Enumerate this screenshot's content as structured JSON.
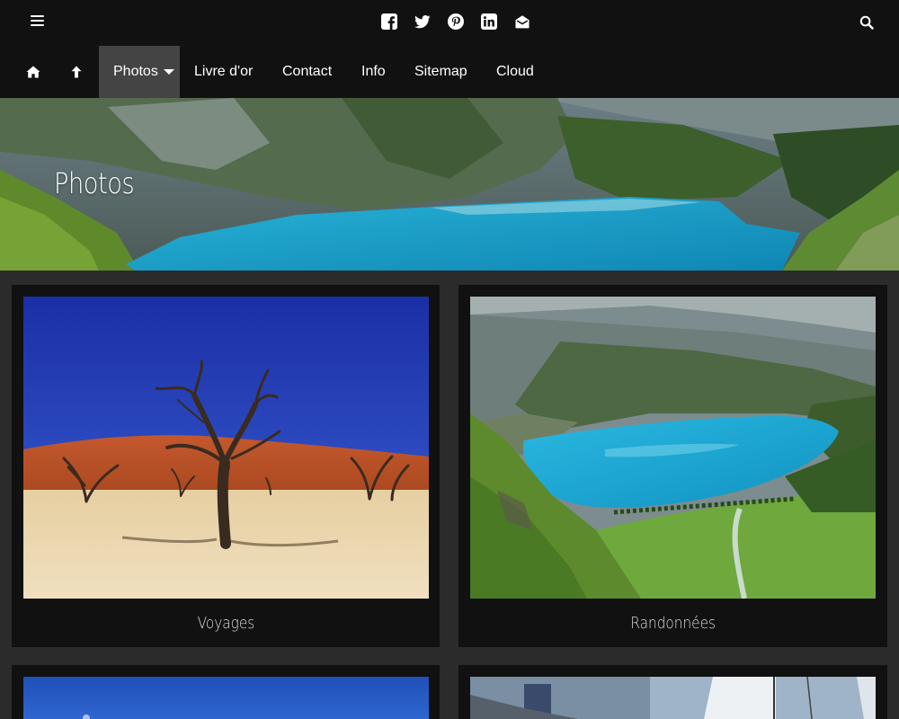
{
  "header": {
    "menu_icon": "hamburger-icon",
    "social_icons": [
      "facebook-icon",
      "twitter-icon",
      "pinterest-icon",
      "linkedin-icon",
      "envelope-open-icon"
    ],
    "search_icon": "search-icon"
  },
  "nav": {
    "home_icon": "home-icon",
    "up_icon": "arrow-up-icon",
    "items": [
      {
        "label": "Photos",
        "active": true,
        "has_dropdown": true
      },
      {
        "label": "Livre d'or"
      },
      {
        "label": "Contact"
      },
      {
        "label": "Info"
      },
      {
        "label": "Sitemap"
      },
      {
        "label": "Cloud"
      }
    ]
  },
  "hero": {
    "title": "Photos"
  },
  "gallery": {
    "items": [
      {
        "caption": "Voyages"
      },
      {
        "caption": "Randonnées"
      }
    ]
  },
  "colors": {
    "bar_bg": "#111111",
    "page_bg": "#2b2b2b",
    "nav_active_bg": "#444444",
    "lake": "#1aa8d0"
  }
}
